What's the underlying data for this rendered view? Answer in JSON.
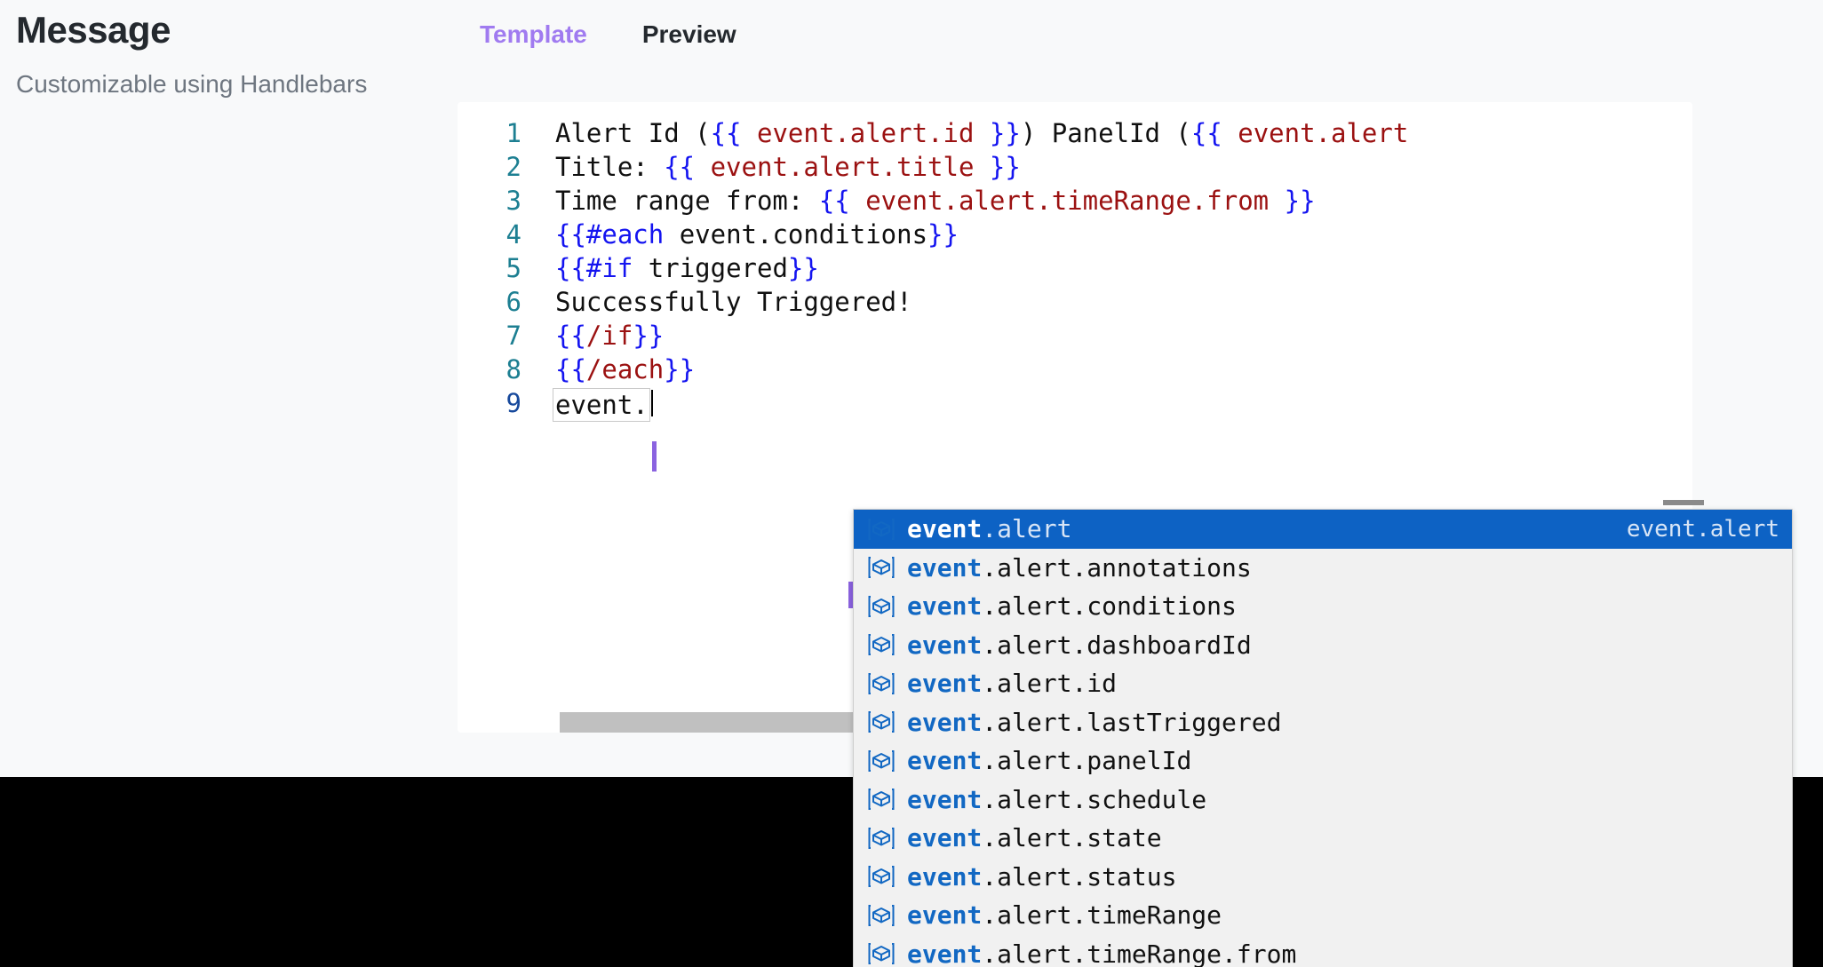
{
  "header": {
    "title": "Message",
    "subtitle": "Customizable using Handlebars"
  },
  "tabs": [
    {
      "label": "Template",
      "active": true
    },
    {
      "label": "Preview",
      "active": false
    }
  ],
  "editor": {
    "language": "handlebars",
    "active_line": 9,
    "cursor_token": "event.",
    "lines": [
      {
        "no": "1",
        "text": "Alert Id ({{ event.alert.id }}) PanelId ({{ event.alert"
      },
      {
        "no": "2",
        "text": "Title: {{ event.alert.title }}"
      },
      {
        "no": "3",
        "text": "Time range from: {{ event.alert.timeRange.from }}"
      },
      {
        "no": "4",
        "text": "{{#each event.conditions}}"
      },
      {
        "no": "5",
        "text": "{{#if triggered}}"
      },
      {
        "no": "6",
        "text": "Successfully Triggered!"
      },
      {
        "no": "7",
        "text": "{{/if}}"
      },
      {
        "no": "8",
        "text": "{{/each}}"
      },
      {
        "no": "9",
        "text": "event."
      }
    ]
  },
  "autocomplete": {
    "icon_name": "property-box-icon",
    "match_prefix": "event",
    "selected_index": 0,
    "selected_detail": "event.alert",
    "items": [
      {
        "label": "event.alert",
        "detail": "event.alert"
      },
      {
        "label": "event.alert.annotations",
        "detail": ""
      },
      {
        "label": "event.alert.conditions",
        "detail": ""
      },
      {
        "label": "event.alert.dashboardId",
        "detail": ""
      },
      {
        "label": "event.alert.id",
        "detail": ""
      },
      {
        "label": "event.alert.lastTriggered",
        "detail": ""
      },
      {
        "label": "event.alert.panelId",
        "detail": ""
      },
      {
        "label": "event.alert.schedule",
        "detail": ""
      },
      {
        "label": "event.alert.state",
        "detail": ""
      },
      {
        "label": "event.alert.status",
        "detail": ""
      },
      {
        "label": "event.alert.timeRange",
        "detail": ""
      },
      {
        "label": "event.alert.timeRange.from",
        "detail": ""
      }
    ]
  },
  "colors": {
    "accent_tab": "#a07bf0",
    "selection_blue": "#0d62c4",
    "token_brace": "#1414f0",
    "token_variable": "#9b1111",
    "line_number": "#1d7f92",
    "page_background": "#f8f9fa",
    "bottom_bar": "#000000"
  }
}
